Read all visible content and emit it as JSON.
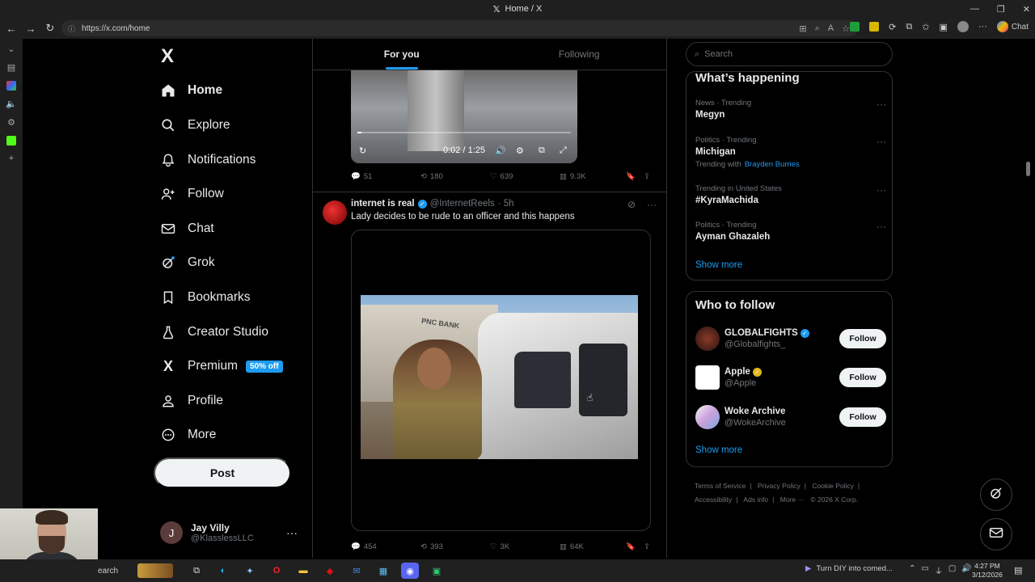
{
  "browser": {
    "window_title": "Home / X",
    "url": "https://x.com/home",
    "chat_label": "Chat"
  },
  "nav": {
    "logo": "X",
    "items": [
      {
        "label": "Home",
        "icon": "home-icon"
      },
      {
        "label": "Explore",
        "icon": "search-icon"
      },
      {
        "label": "Notifications",
        "icon": "bell-icon"
      },
      {
        "label": "Follow",
        "icon": "person-add-icon"
      },
      {
        "label": "Chat",
        "icon": "mail-icon"
      },
      {
        "label": "Grok",
        "icon": "grok-icon"
      },
      {
        "label": "Bookmarks",
        "icon": "bookmark-icon"
      },
      {
        "label": "Creator Studio",
        "icon": "creator-icon"
      },
      {
        "label": "Premium",
        "icon": "x-icon",
        "badge": "50% off"
      },
      {
        "label": "Profile",
        "icon": "profile-icon"
      },
      {
        "label": "More",
        "icon": "more-circle-icon"
      }
    ],
    "post_label": "Post",
    "account": {
      "initial": "J",
      "name": "Jay Villy",
      "handle": "@KlasslessLLC"
    }
  },
  "feed": {
    "tabs": [
      "For you",
      "Following"
    ],
    "video1": {
      "time": "0:02 / 1:25",
      "progress": 0.02
    },
    "tweet1_stats": {
      "replies": "51",
      "reposts": "180",
      "likes": "639",
      "views": "9.3K"
    },
    "tweet2": {
      "name": "internet is real",
      "handle": "@InternetReels",
      "time": "· 5h",
      "text": "Lady decides to be rude to an officer and this happens",
      "video_sign": "PNC BANK",
      "stats": {
        "replies": "454",
        "reposts": "393",
        "likes": "3K",
        "views": "64K"
      }
    }
  },
  "sidebar": {
    "search_placeholder": "Search",
    "happening_title": "What’s happening",
    "trends": [
      {
        "meta": "News · Trending",
        "name": "Megyn"
      },
      {
        "meta": "Politics · Trending",
        "name": "Michigan",
        "with_label": "Trending with",
        "with_link": "Brayden Burries"
      },
      {
        "meta": "Trending in United States",
        "name": "#KyraMachida"
      },
      {
        "meta": "Politics · Trending",
        "name": "Ayman Ghazaleh"
      }
    ],
    "show_more": "Show more",
    "wtf_title": "Who to follow",
    "who_to_follow": [
      {
        "name": "GLOBALFIGHTS",
        "handle": "@Globalfights_",
        "button": "Follow"
      },
      {
        "name": "Apple",
        "handle": "@Apple",
        "button": "Follow"
      },
      {
        "name": "Woke Archive",
        "handle": "@WokeArchive",
        "button": "Follow"
      }
    ],
    "footer": [
      "Terms of Service",
      "Privacy Policy",
      "Cookie Policy",
      "Accessibility",
      "Ads info",
      "More ···",
      "© 2026 X Corp."
    ]
  },
  "taskbar": {
    "search": "earch",
    "news": "Turn DIY into comed...",
    "time": "4:27 PM",
    "date": "3/12/2026"
  },
  "colors": {
    "accent": "#1d9bf0",
    "background": "#000000",
    "border": "#2f3336",
    "muted": "#71767b"
  }
}
